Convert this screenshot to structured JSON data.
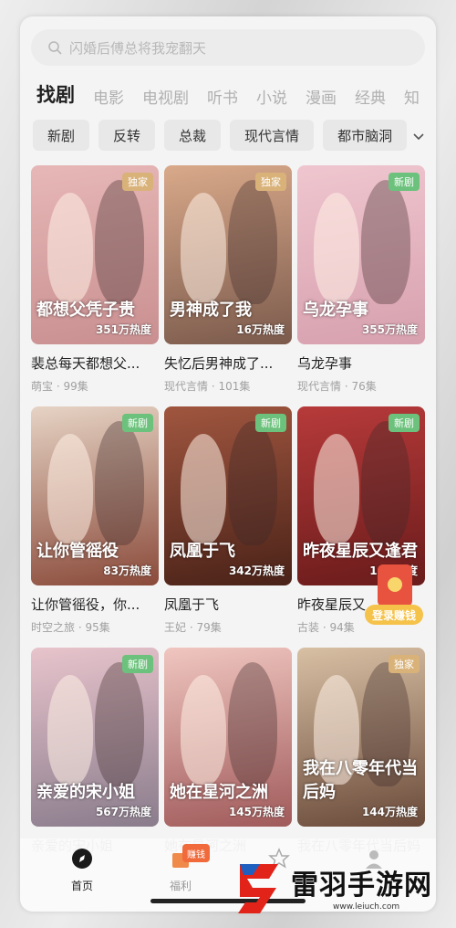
{
  "search": {
    "placeholder": "闪婚后傅总将我宠翻天"
  },
  "tabs": [
    "找剧",
    "电影",
    "电视剧",
    "听书",
    "小说",
    "漫画",
    "经典",
    "知"
  ],
  "chips": [
    "新剧",
    "反转",
    "总裁",
    "现代言情",
    "都市脑洞"
  ],
  "cards": [
    {
      "title": "裴总每天都想父凭子贵",
      "title_display": "裴总每天都想父...",
      "meta": "萌宝 · 99集",
      "badge": "独家",
      "badge_color": "tan",
      "heat": "351万热度",
      "poster_text": "都想父凭子贵",
      "colors": [
        "#e7b7b7",
        "#c98f90"
      ]
    },
    {
      "title": "失忆后男神成了...",
      "title_display": "失忆后男神成了...",
      "meta": "现代言情 · 101集",
      "badge": "独家",
      "badge_color": "tan",
      "heat": "16万热度",
      "poster_text": "男神成了我",
      "colors": [
        "#d9a98a",
        "#7b5a4c"
      ]
    },
    {
      "title": "乌龙孕事",
      "title_display": "乌龙孕事",
      "meta": "现代言情 · 76集",
      "badge": "新剧",
      "badge_color": "green",
      "heat": "355万热度",
      "poster_text": "乌龙孕事",
      "colors": [
        "#efc6cf",
        "#d7a0ae"
      ]
    },
    {
      "title": "让你管徭役，你...",
      "title_display": "让你管徭役，你...",
      "meta": "时空之旅 · 95集",
      "badge": "新剧",
      "badge_color": "green",
      "heat": "83万热度",
      "poster_text": "让你管徭役",
      "colors": [
        "#e6d3c4",
        "#8a4a3a"
      ]
    },
    {
      "title": "凤凰于飞",
      "title_display": "凤凰于飞",
      "meta": "王妃 · 79集",
      "badge": "新剧",
      "badge_color": "green",
      "heat": "342万热度",
      "poster_text": "凤凰于飞",
      "colors": [
        "#a0563f",
        "#4a2218"
      ]
    },
    {
      "title": "昨夜星辰又逢君",
      "title_display": "昨夜星辰又",
      "meta": "古装 · 94集",
      "badge": "新剧",
      "badge_color": "green",
      "heat": "16万热度",
      "poster_text": "昨夜星辰又逢君",
      "colors": [
        "#b73a3a",
        "#6a1b1b"
      ]
    },
    {
      "title": "亲爱的宋小姐",
      "title_display": "亲爱的宋小姐",
      "meta": "",
      "badge": "新剧",
      "badge_color": "green",
      "heat": "567万热度",
      "poster_text": "亲爱的宋小姐",
      "colors": [
        "#e8c4cc",
        "#8a7c8c"
      ]
    },
    {
      "title": "她在星河之洲",
      "title_display": "她在星河之洲",
      "meta": "",
      "badge": "",
      "badge_color": "",
      "heat": "145万热度",
      "poster_text": "她在星河之洲",
      "colors": [
        "#f0c6c0",
        "#a05a5a"
      ]
    },
    {
      "title": "我在八零年代当后妈",
      "title_display": "我在八零年代当后妈",
      "meta": "",
      "badge": "独家",
      "badge_color": "tan",
      "heat": "144万热度",
      "poster_text": "我在八零年代当后妈",
      "colors": [
        "#d8c0a4",
        "#6a4a3a"
      ]
    }
  ],
  "reward": {
    "label": "登录赚钱"
  },
  "nav": {
    "home": "首页",
    "welfare": "福利",
    "earn_badge": "赚钱",
    "favorites": "",
    "profile": ""
  },
  "watermark": {
    "name": "雷羽手游网",
    "url": "www.leiuch.com"
  }
}
